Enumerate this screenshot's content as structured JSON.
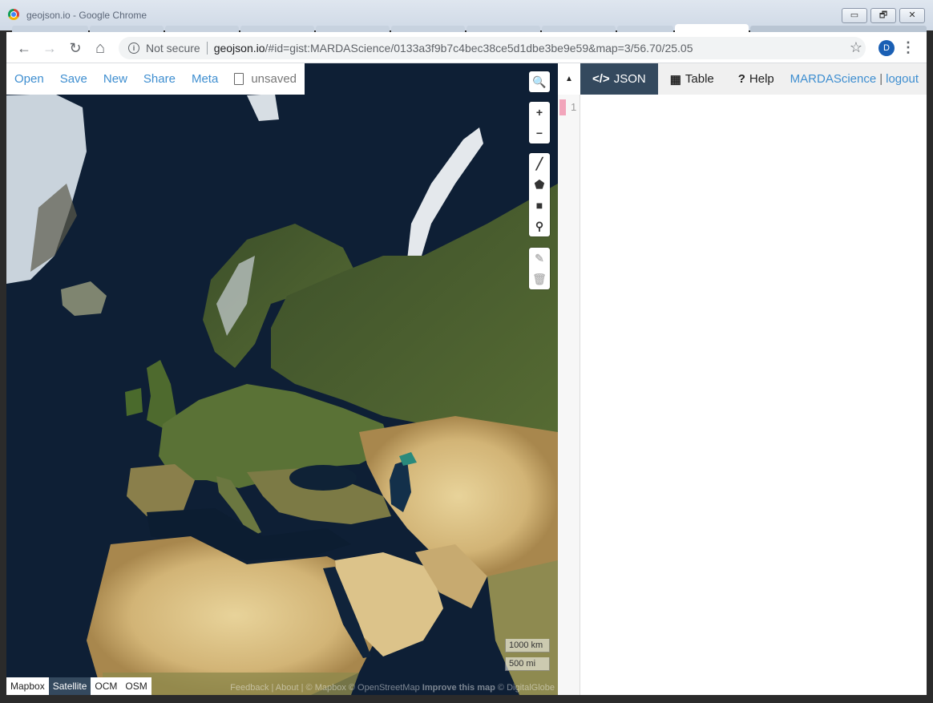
{
  "window": {
    "title": "geojson.io - Google Chrome",
    "minimize": "▭",
    "restore": "🗗",
    "close": "✕"
  },
  "browser": {
    "back_icon": "←",
    "forward_icon": "→",
    "reload_icon": "↻",
    "home_icon": "⌂",
    "security_label": "Not secure",
    "url_host": "geojson.io",
    "url_rest": "/#id=gist:MARDAScience/0133a3f9b7c4bec38ce5d1dbe3be9e59&map=3/56.70/25.05",
    "bookmark_icon": "☆",
    "profile_initial": "D",
    "menu_icon": "⋮"
  },
  "app": {
    "menu": [
      "Open",
      "Save",
      "New",
      "Share",
      "Meta"
    ],
    "file_status": "unsaved",
    "map_controls": {
      "search": "🔍",
      "zoom_in": "+",
      "zoom_out": "−",
      "draw_line": "╱",
      "draw_polygon": "⬟",
      "draw_rectangle": "■",
      "draw_marker": "⚲",
      "edit": "✎",
      "delete": "🗑"
    },
    "scale": {
      "metric": "1000 km",
      "imperial": "500 mi"
    },
    "layers": [
      {
        "label": "Mapbox",
        "active": false
      },
      {
        "label": "Satellite",
        "active": true
      },
      {
        "label": "OCM",
        "active": false
      },
      {
        "label": "OSM",
        "active": false
      }
    ],
    "attribution": {
      "text": "Feedback | About | © Mapbox © OpenStreetMap",
      "improve": "Improve this map",
      "credit": "© DigitalGlobe"
    },
    "collapse_icon": "▲",
    "tabs": [
      {
        "icon": "</>",
        "label": "JSON",
        "active": true
      },
      {
        "icon": "▦",
        "label": "Table",
        "active": false
      },
      {
        "icon": "?",
        "label": "Help",
        "active": false
      }
    ],
    "user": {
      "name": "MARDAScience",
      "separator": "|",
      "logout": "logout"
    },
    "editor": {
      "line_number": "1"
    }
  },
  "colors": {
    "accent": "#3e8ed0",
    "dark_tab": "#34495e",
    "ocean": "#0d1e33"
  }
}
